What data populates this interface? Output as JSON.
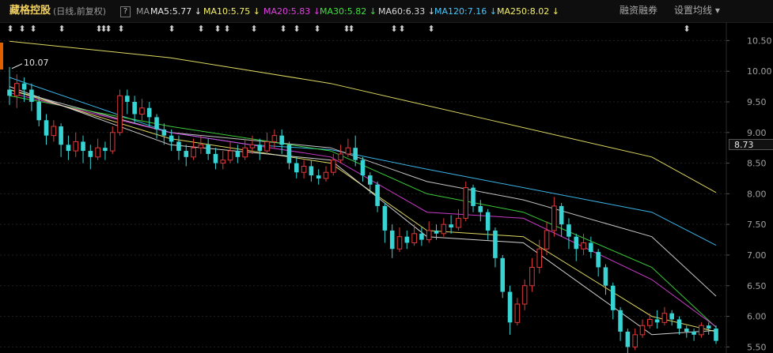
{
  "header": {
    "stock_name": "藏格控股",
    "period": "(日线,前复权)",
    "help": "?",
    "ma_label": "MA",
    "ma5": "MA5:5.77 ↓",
    "ma10": "MA10:5.75 ↓",
    "ma20": "MA20:5.83 ↓",
    "ma30": "MA30:5.82 ↓",
    "ma60": "MA60:6.33 ↓",
    "ma120": "MA120:7.16 ↓",
    "ma250": "MA250:8.02 ↓",
    "financing": "融资融券",
    "set_ma": "设置均线 ▾"
  },
  "colors": {
    "background": "#000000",
    "up": "#e03a3a",
    "down": "#38d4d4",
    "ma5": "#e8e8e8",
    "ma10": "#f5f06a",
    "ma20": "#e040e0",
    "ma30": "#40e040",
    "ma60": "#d8d8d8",
    "ma120": "#40c8ff",
    "ma250": "#f5f06a"
  },
  "chart_data": {
    "type": "candlestick",
    "y_ticks": [
      "10.50",
      "10.00",
      "9.50",
      "9.00",
      "8.50",
      "8.00",
      "7.50",
      "7.00",
      "6.50",
      "6.00",
      "5.50"
    ],
    "ylim": [
      5.35,
      10.75
    ],
    "current_price": "8.73",
    "annotations": {
      "high": "10.07",
      "low": "5.38"
    },
    "event_marker": "⬍",
    "candles": [
      [
        9.7,
        9.6,
        10.07,
        9.45
      ],
      [
        9.6,
        9.8,
        9.95,
        9.4
      ],
      [
        9.8,
        9.7,
        9.9,
        9.5
      ],
      [
        9.7,
        9.5,
        9.8,
        9.35
      ],
      [
        9.5,
        9.2,
        9.6,
        9.1
      ],
      [
        9.2,
        8.95,
        9.3,
        8.8
      ],
      [
        8.95,
        9.1,
        9.2,
        8.85
      ],
      [
        9.1,
        8.8,
        9.15,
        8.6
      ],
      [
        8.8,
        8.7,
        8.95,
        8.55
      ],
      [
        8.7,
        8.85,
        9.0,
        8.6
      ],
      [
        8.85,
        8.7,
        8.95,
        8.5
      ],
      [
        8.7,
        8.6,
        8.8,
        8.4
      ],
      [
        8.6,
        8.75,
        8.9,
        8.55
      ],
      [
        8.75,
        8.7,
        8.85,
        8.55
      ],
      [
        8.7,
        9.0,
        9.1,
        8.65
      ],
      [
        9.0,
        9.6,
        9.7,
        8.95
      ],
      [
        9.6,
        9.5,
        9.7,
        9.3
      ],
      [
        9.5,
        9.3,
        9.6,
        9.15
      ],
      [
        9.3,
        9.4,
        9.55,
        9.2
      ],
      [
        9.4,
        9.25,
        9.5,
        9.1
      ],
      [
        9.25,
        9.05,
        9.3,
        8.9
      ],
      [
        9.05,
        8.95,
        9.15,
        8.8
      ],
      [
        8.95,
        8.85,
        9.05,
        8.7
      ],
      [
        8.85,
        8.7,
        8.95,
        8.55
      ],
      [
        8.7,
        8.6,
        8.8,
        8.45
      ],
      [
        8.6,
        8.75,
        8.9,
        8.55
      ],
      [
        8.75,
        8.8,
        8.95,
        8.65
      ],
      [
        8.8,
        8.65,
        8.9,
        8.55
      ],
      [
        8.65,
        8.5,
        8.75,
        8.4
      ],
      [
        8.5,
        8.55,
        8.7,
        8.4
      ],
      [
        8.55,
        8.7,
        8.85,
        8.5
      ],
      [
        8.7,
        8.6,
        8.8,
        8.5
      ],
      [
        8.6,
        8.75,
        8.9,
        8.55
      ],
      [
        8.75,
        8.8,
        8.95,
        8.65
      ],
      [
        8.8,
        8.7,
        8.9,
        8.55
      ],
      [
        8.7,
        8.85,
        9.0,
        8.65
      ],
      [
        8.85,
        8.95,
        9.05,
        8.75
      ],
      [
        8.95,
        8.8,
        9.05,
        8.65
      ],
      [
        8.8,
        8.5,
        8.85,
        8.4
      ],
      [
        8.5,
        8.35,
        8.6,
        8.25
      ],
      [
        8.35,
        8.45,
        8.55,
        8.25
      ],
      [
        8.45,
        8.3,
        8.55,
        8.2
      ],
      [
        8.3,
        8.25,
        8.4,
        8.15
      ],
      [
        8.25,
        8.35,
        8.45,
        8.2
      ],
      [
        8.35,
        8.55,
        8.65,
        8.3
      ],
      [
        8.55,
        8.65,
        8.8,
        8.5
      ],
      [
        8.65,
        8.75,
        8.9,
        8.6
      ],
      [
        8.75,
        8.55,
        8.95,
        8.45
      ],
      [
        8.55,
        8.3,
        8.6,
        8.2
      ],
      [
        8.3,
        8.15,
        8.35,
        8.0
      ],
      [
        8.15,
        7.8,
        8.2,
        7.7
      ],
      [
        7.8,
        7.4,
        7.85,
        7.2
      ],
      [
        7.4,
        7.1,
        7.5,
        6.95
      ],
      [
        7.1,
        7.3,
        7.45,
        7.05
      ],
      [
        7.3,
        7.2,
        7.4,
        7.1
      ],
      [
        7.2,
        7.35,
        7.5,
        7.15
      ],
      [
        7.35,
        7.25,
        7.45,
        7.15
      ],
      [
        7.25,
        7.4,
        7.55,
        7.2
      ],
      [
        7.4,
        7.35,
        7.5,
        7.25
      ],
      [
        7.35,
        7.5,
        7.6,
        7.3
      ],
      [
        7.5,
        7.45,
        7.65,
        7.35
      ],
      [
        7.45,
        7.6,
        7.75,
        7.4
      ],
      [
        7.6,
        8.1,
        8.2,
        7.55
      ],
      [
        8.1,
        7.8,
        8.15,
        7.7
      ],
      [
        7.8,
        7.7,
        7.9,
        7.55
      ],
      [
        7.7,
        7.4,
        7.75,
        7.25
      ],
      [
        7.4,
        6.95,
        7.45,
        6.8
      ],
      [
        6.95,
        6.4,
        7.0,
        6.3
      ],
      [
        6.4,
        5.9,
        6.5,
        5.7
      ],
      [
        5.9,
        6.2,
        6.3,
        5.85
      ],
      [
        6.2,
        6.5,
        6.6,
        6.1
      ],
      [
        6.5,
        6.8,
        6.95,
        6.4
      ],
      [
        6.8,
        7.1,
        7.25,
        6.7
      ],
      [
        7.1,
        7.4,
        7.55,
        7.0
      ],
      [
        7.4,
        7.8,
        7.95,
        7.3
      ],
      [
        7.8,
        7.5,
        7.85,
        7.3
      ],
      [
        7.5,
        7.3,
        7.6,
        7.1
      ],
      [
        7.3,
        7.1,
        7.35,
        6.9
      ],
      [
        7.1,
        7.2,
        7.35,
        7.0
      ],
      [
        7.2,
        7.05,
        7.3,
        6.95
      ],
      [
        7.05,
        6.8,
        7.1,
        6.65
      ],
      [
        6.8,
        6.5,
        6.85,
        6.35
      ],
      [
        6.5,
        6.1,
        6.55,
        5.95
      ],
      [
        6.1,
        5.75,
        6.15,
        5.6
      ],
      [
        5.75,
        5.5,
        5.8,
        5.38
      ],
      [
        5.5,
        5.7,
        5.8,
        5.45
      ],
      [
        5.7,
        5.85,
        5.95,
        5.65
      ],
      [
        5.85,
        5.95,
        6.05,
        5.8
      ],
      [
        5.95,
        5.9,
        6.1,
        5.8
      ],
      [
        5.9,
        6.05,
        6.15,
        5.85
      ],
      [
        6.05,
        5.95,
        6.1,
        5.85
      ],
      [
        5.95,
        5.8,
        6.0,
        5.7
      ],
      [
        5.8,
        5.75,
        5.85,
        5.65
      ],
      [
        5.75,
        5.7,
        5.8,
        5.6
      ],
      [
        5.7,
        5.85,
        5.9,
        5.65
      ],
      [
        5.85,
        5.8,
        5.9,
        5.7
      ],
      [
        5.8,
        5.6,
        5.85,
        5.55
      ]
    ],
    "moving_averages": {
      "ma250": [
        [
          0,
          10.49
        ],
        [
          0.5,
          10.22
        ],
        [
          1,
          9.8
        ],
        [
          1.5,
          9.2
        ],
        [
          2,
          8.6
        ],
        [
          2.2,
          8.02
        ]
      ],
      "ma120": [
        [
          0,
          9.9
        ],
        [
          0.5,
          9.0
        ],
        [
          0.75,
          8.8
        ],
        [
          1,
          8.72
        ],
        [
          1.3,
          8.4
        ],
        [
          2,
          7.7
        ],
        [
          2.2,
          7.16
        ]
      ],
      "ma60": [
        [
          0,
          9.7
        ],
        [
          0.5,
          9.0
        ],
        [
          1,
          8.75
        ],
        [
          1.3,
          8.2
        ],
        [
          1.6,
          7.9
        ],
        [
          2,
          7.3
        ],
        [
          2.2,
          6.33
        ]
      ],
      "ma30": [
        [
          0,
          9.6
        ],
        [
          0.5,
          9.1
        ],
        [
          1,
          8.7
        ],
        [
          1.3,
          8.0
        ],
        [
          1.6,
          7.7
        ],
        [
          2,
          6.8
        ],
        [
          2.2,
          5.82
        ]
      ],
      "ma20": [
        [
          0,
          9.65
        ],
        [
          0.5,
          9.0
        ],
        [
          1,
          8.6
        ],
        [
          1.3,
          7.7
        ],
        [
          1.6,
          7.6
        ],
        [
          2,
          6.6
        ],
        [
          2.2,
          5.83
        ]
      ],
      "ma10": [
        [
          0,
          9.7
        ],
        [
          0.5,
          8.9
        ],
        [
          1,
          8.5
        ],
        [
          1.3,
          7.4
        ],
        [
          1.6,
          7.3
        ],
        [
          2,
          6.0
        ],
        [
          2.2,
          5.75
        ]
      ],
      "ma5": [
        [
          0,
          9.75
        ],
        [
          0.5,
          8.8
        ],
        [
          1,
          8.55
        ],
        [
          1.3,
          7.3
        ],
        [
          1.6,
          7.2
        ],
        [
          2,
          5.7
        ],
        [
          2.2,
          5.77
        ]
      ]
    }
  }
}
